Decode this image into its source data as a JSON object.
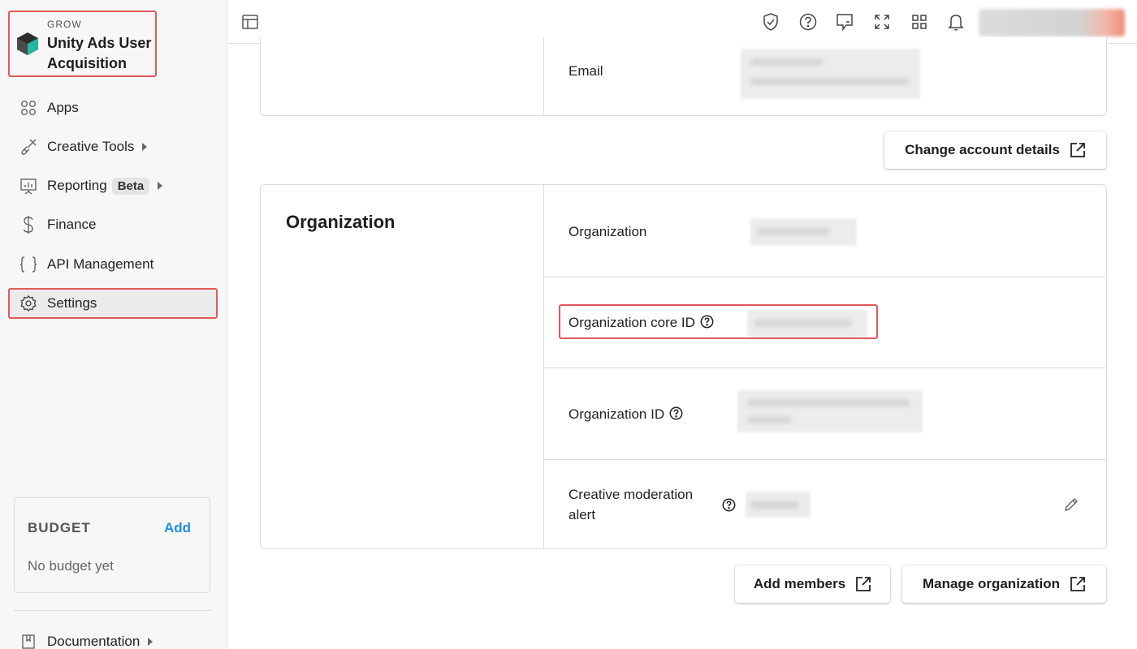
{
  "sidebar": {
    "brand": {
      "eyebrow": "GROW",
      "name": "Unity Ads User Acquisition"
    },
    "items": [
      {
        "label": "Apps"
      },
      {
        "label": "Creative Tools"
      },
      {
        "label": "Reporting",
        "badge": "Beta"
      },
      {
        "label": "Finance"
      },
      {
        "label": "API Management"
      },
      {
        "label": "Settings"
      }
    ],
    "budget": {
      "title": "BUDGET",
      "add_label": "Add",
      "empty_text": "No budget yet"
    },
    "documentation": "Documentation"
  },
  "topbar": {
    "icons": [
      "layout-toggle-icon",
      "shield-check-icon",
      "help-icon",
      "feedback-icon",
      "fullscreen-icon",
      "apps-grid-icon",
      "bell-icon"
    ]
  },
  "account": {
    "email_label": "Email",
    "change_details_label": "Change account details"
  },
  "organization": {
    "title": "Organization",
    "fields": {
      "organization": "Organization",
      "core_id": "Organization core ID",
      "org_id": "Organization ID",
      "moderation": "Creative moderation alert"
    },
    "add_members_label": "Add members",
    "manage_label": "Manage organization"
  },
  "colors": {
    "highlight": "#e05a5a",
    "link": "#1f8fe6",
    "sidebar_bg": "#f7f7f7"
  }
}
